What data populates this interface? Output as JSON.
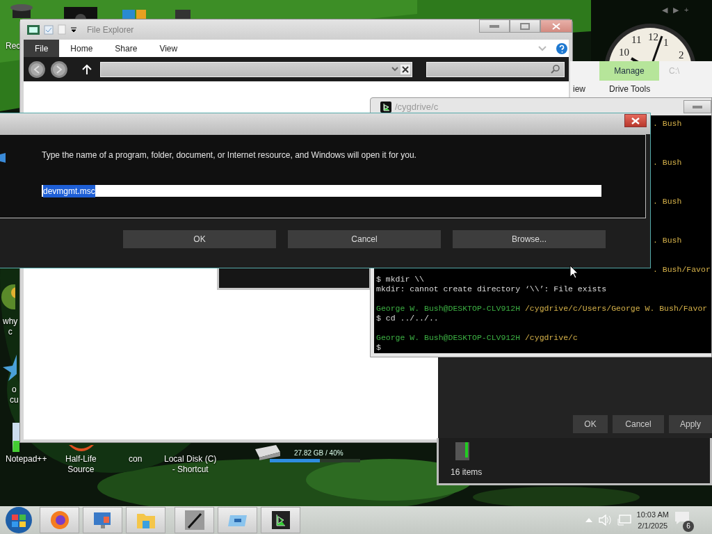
{
  "desktop": {
    "icons": [
      {
        "kind": "bin",
        "label": "Rec"
      },
      {
        "kind": "globe",
        "label": "why\nc"
      },
      {
        "kind": "star",
        "label": "o\ncu"
      },
      {
        "kind": "notepad",
        "label": "Notepad++"
      },
      {
        "kind": "game",
        "label": "Half-Life\nSource"
      },
      {
        "kind": "none",
        "label": "con"
      },
      {
        "kind": "none",
        "label": "Local Disk (C)\n- Shortcut"
      }
    ]
  },
  "drive_gadget": {
    "text": "27.82 GB / 40%",
    "level": 0.55
  },
  "gadget_controls": [
    "◀",
    "▶",
    "+"
  ],
  "clock": {
    "numerals": [
      "10",
      "11",
      "12",
      "1",
      "2"
    ]
  },
  "explorer": {
    "title": "File Explorer",
    "tabs": [
      {
        "label": "File",
        "selected": true
      },
      {
        "label": "Home",
        "selected": false
      },
      {
        "label": "Share",
        "selected": false
      },
      {
        "label": "View",
        "selected": false
      }
    ]
  },
  "drive_window": {
    "tabs": [
      {
        "label": "Manage",
        "selected": true
      },
      {
        "label": "C:\\",
        "selected": false
      }
    ],
    "subtabs": [
      "iew",
      "Drive Tools"
    ]
  },
  "properties_dialog": {
    "buttons": [
      "OK",
      "Cancel",
      "Apply"
    ]
  },
  "folder_window": {
    "status": "16 items"
  },
  "terminal": {
    "title": "/cygdrive/c",
    "lines": [
      {
        "kind": "covered",
        "text": ". Bush"
      },
      {
        "kind": "covered",
        "text": ". Bush"
      },
      {
        "kind": "covered",
        "text": ". Bush"
      },
      {
        "kind": "covered",
        "text": ". Bush"
      },
      {
        "kind": "covered",
        "text": ". Bush/Favor"
      },
      {
        "kind": "output",
        "text": "$ mkdir \\\\"
      },
      {
        "kind": "output",
        "text": "mkdir: cannot create directory ‘\\\\’: File exists"
      },
      {
        "kind": "blank"
      },
      {
        "kind": "prompt",
        "user": "George W. Bush@DESKTOP-CLV912H",
        "path": "/cygdrive/c/Users/George W. Bush/Favor"
      },
      {
        "kind": "output",
        "text": "$ cd ../../.."
      },
      {
        "kind": "blank"
      },
      {
        "kind": "prompt",
        "user": "George W. Bush@DESKTOP-CLV912H",
        "path": "/cygdrive/c"
      },
      {
        "kind": "output",
        "text": "$"
      }
    ]
  },
  "run_dialog": {
    "prompt": "Type the name of a program, folder, document, or Internet resource, and Windows will open it for you.",
    "value": "devmgmt.msc",
    "buttons": [
      "OK",
      "Cancel",
      "Browse..."
    ]
  },
  "taskbar": {
    "apps": [
      {
        "kind": "browser"
      },
      {
        "kind": "computer"
      },
      {
        "kind": "folder"
      },
      {
        "kind": "pen"
      },
      {
        "kind": "window"
      },
      {
        "kind": "terminal"
      }
    ]
  },
  "tray": {
    "time": "10:03 AM",
    "date": "2/1/2025",
    "notifications": "6"
  }
}
